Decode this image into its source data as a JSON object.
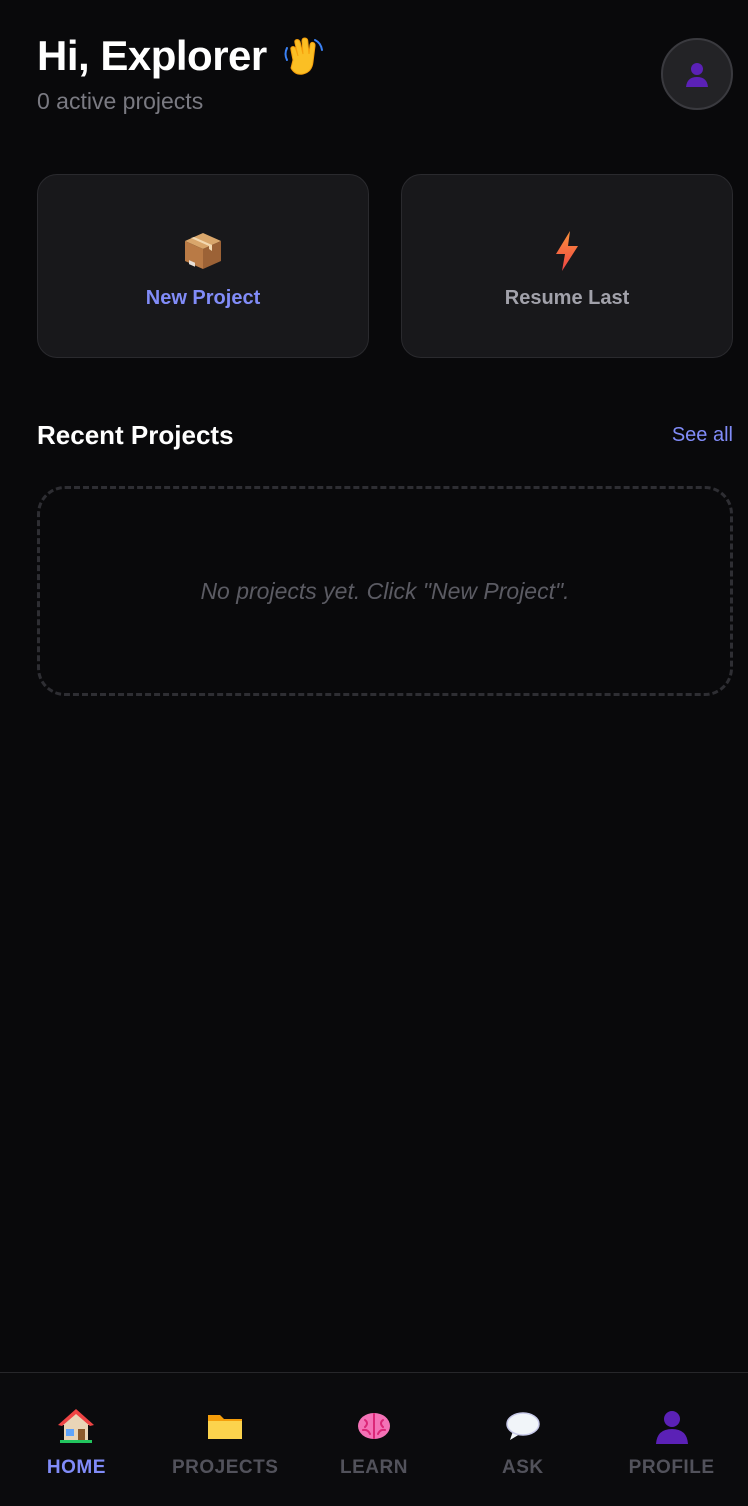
{
  "header": {
    "greeting": "Hi, Explorer",
    "subtitle": "0 active projects"
  },
  "icons": {
    "wave": "waving-hand",
    "avatar": "person-silhouette",
    "new_project": "package-box",
    "resume_last": "lightning-bolt"
  },
  "actions": {
    "new_project_label": "New Project",
    "resume_last_label": "Resume Last"
  },
  "recent": {
    "title": "Recent Projects",
    "see_all": "See all",
    "empty_message": "No projects yet. Click \"New Project\"."
  },
  "nav": {
    "items": [
      {
        "label": "HOME",
        "icon": "house-icon",
        "active": true
      },
      {
        "label": "PROJECTS",
        "icon": "folder-icon",
        "active": false
      },
      {
        "label": "LEARN",
        "icon": "brain-icon",
        "active": false
      },
      {
        "label": "ASK",
        "icon": "speech-bubble-icon",
        "active": false
      },
      {
        "label": "PROFILE",
        "icon": "person-icon",
        "active": false
      }
    ]
  },
  "colors": {
    "background": "#09090b",
    "card": "#18181b",
    "accent": "#818cf8",
    "muted": "#a1a1aa",
    "inactive_nav": "#52525b"
  }
}
